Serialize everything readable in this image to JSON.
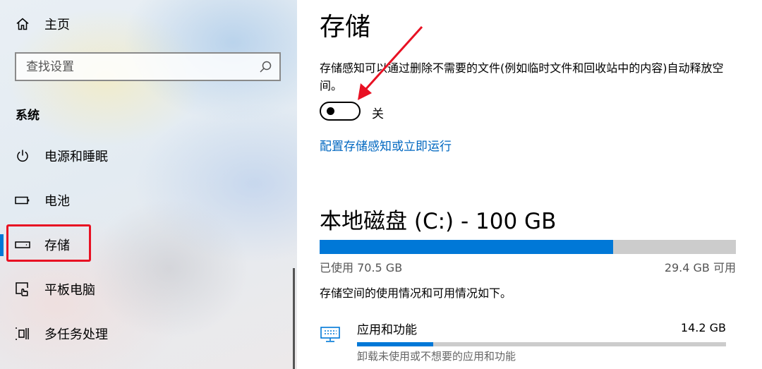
{
  "sidebar": {
    "home_label": "主页",
    "search_placeholder": "查找设置",
    "section_title": "系统",
    "items": [
      {
        "label": "电源和睡眠",
        "icon": "power-icon"
      },
      {
        "label": "电池",
        "icon": "battery-icon"
      },
      {
        "label": "存储",
        "icon": "storage-drive-icon",
        "selected": true
      },
      {
        "label": "平板电脑",
        "icon": "tablet-mode-icon"
      },
      {
        "label": "多任务处理",
        "icon": "multitasking-icon"
      }
    ]
  },
  "main": {
    "title": "存储",
    "storage_sense_description": "存储感知可以通过删除不需要的文件(例如临时文件和回收站中的内容)自动释放空间。",
    "toggle": {
      "state_label": "关",
      "on": false
    },
    "configure_link": "配置存储感知或立即运行",
    "drive": {
      "title": "本地磁盘 (C:) - 100 GB",
      "used_label": "已使用 70.5 GB",
      "free_label": "29.4 GB 可用",
      "used_fraction": 0.705
    },
    "usage_info": "存储空间的使用情况和可用情况如下。",
    "categories": [
      {
        "name": "应用和功能",
        "size": "14.2 GB",
        "description": "卸载未使用或不想要的应用和功能",
        "fraction": 0.206,
        "icon": "apps-features-icon"
      }
    ]
  },
  "colors": {
    "accent": "#0078d7",
    "link": "#0067c0",
    "annotation": "#e81123"
  }
}
